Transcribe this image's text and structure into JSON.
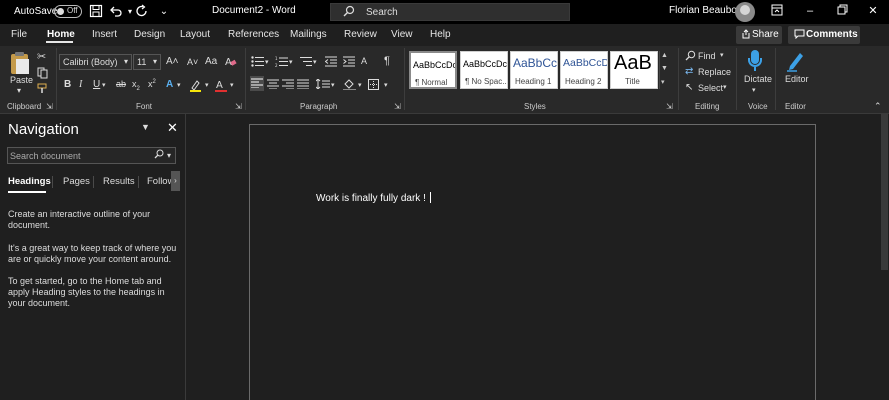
{
  "titlebar": {
    "autosave_label": "AutoSave",
    "autosave_state": "Off",
    "document_title": "Document2  -  Word",
    "search_placeholder": "Search",
    "user_name": "Florian Beaubois"
  },
  "menu": {
    "tabs": [
      "File",
      "Home",
      "Insert",
      "Design",
      "Layout",
      "References",
      "Mailings",
      "Review",
      "View",
      "Help"
    ],
    "active_tab": "Home",
    "share_label": "Share",
    "comments_label": "Comments"
  },
  "ribbon": {
    "clipboard": {
      "paste_label": "Paste",
      "group_label": "Clipboard"
    },
    "font": {
      "font_name": "Calibri (Body)",
      "font_size": "11",
      "grow_label": "A˄",
      "shrink_label": "A˅",
      "case_label": "Aa",
      "group_label": "Font"
    },
    "paragraph": {
      "group_label": "Paragraph"
    },
    "styles": {
      "group_label": "Styles",
      "items": [
        {
          "preview": "AaBbCcDc",
          "name": "¶ Normal"
        },
        {
          "preview": "AaBbCcDc",
          "name": "¶ No Spac..."
        },
        {
          "preview": "AaBbCc",
          "name": "Heading 1"
        },
        {
          "preview": "AaBbCcD",
          "name": "Heading 2"
        },
        {
          "preview": "AaB",
          "name": "Title"
        }
      ]
    },
    "editing": {
      "group_label": "Editing",
      "find_label": "Find",
      "replace_label": "Replace",
      "select_label": "Select"
    },
    "voice": {
      "dictate_label": "Dictate",
      "group_label": "Voice"
    },
    "editor": {
      "editor_label": "Editor",
      "group_label": "Editor"
    }
  },
  "navigation": {
    "title": "Navigation",
    "search_placeholder": "Search document",
    "tabs": [
      "Headings",
      "Pages",
      "Results",
      "Follow"
    ],
    "active_tab": "Headings",
    "paragraphs": [
      "Create an interactive outline of your document.",
      "It's a great way to keep track of where you are or quickly move your content around.",
      "To get started, go to the Home tab and apply Heading styles to the headings in your document."
    ]
  },
  "document": {
    "text": "Work is finally fully dark !"
  },
  "colors": {
    "background": "#1f1f1f",
    "titlebar": "#000000",
    "ribbon": "#292929",
    "accent_blue": "#3ca0e6",
    "heading_blue": "#2f5496"
  }
}
